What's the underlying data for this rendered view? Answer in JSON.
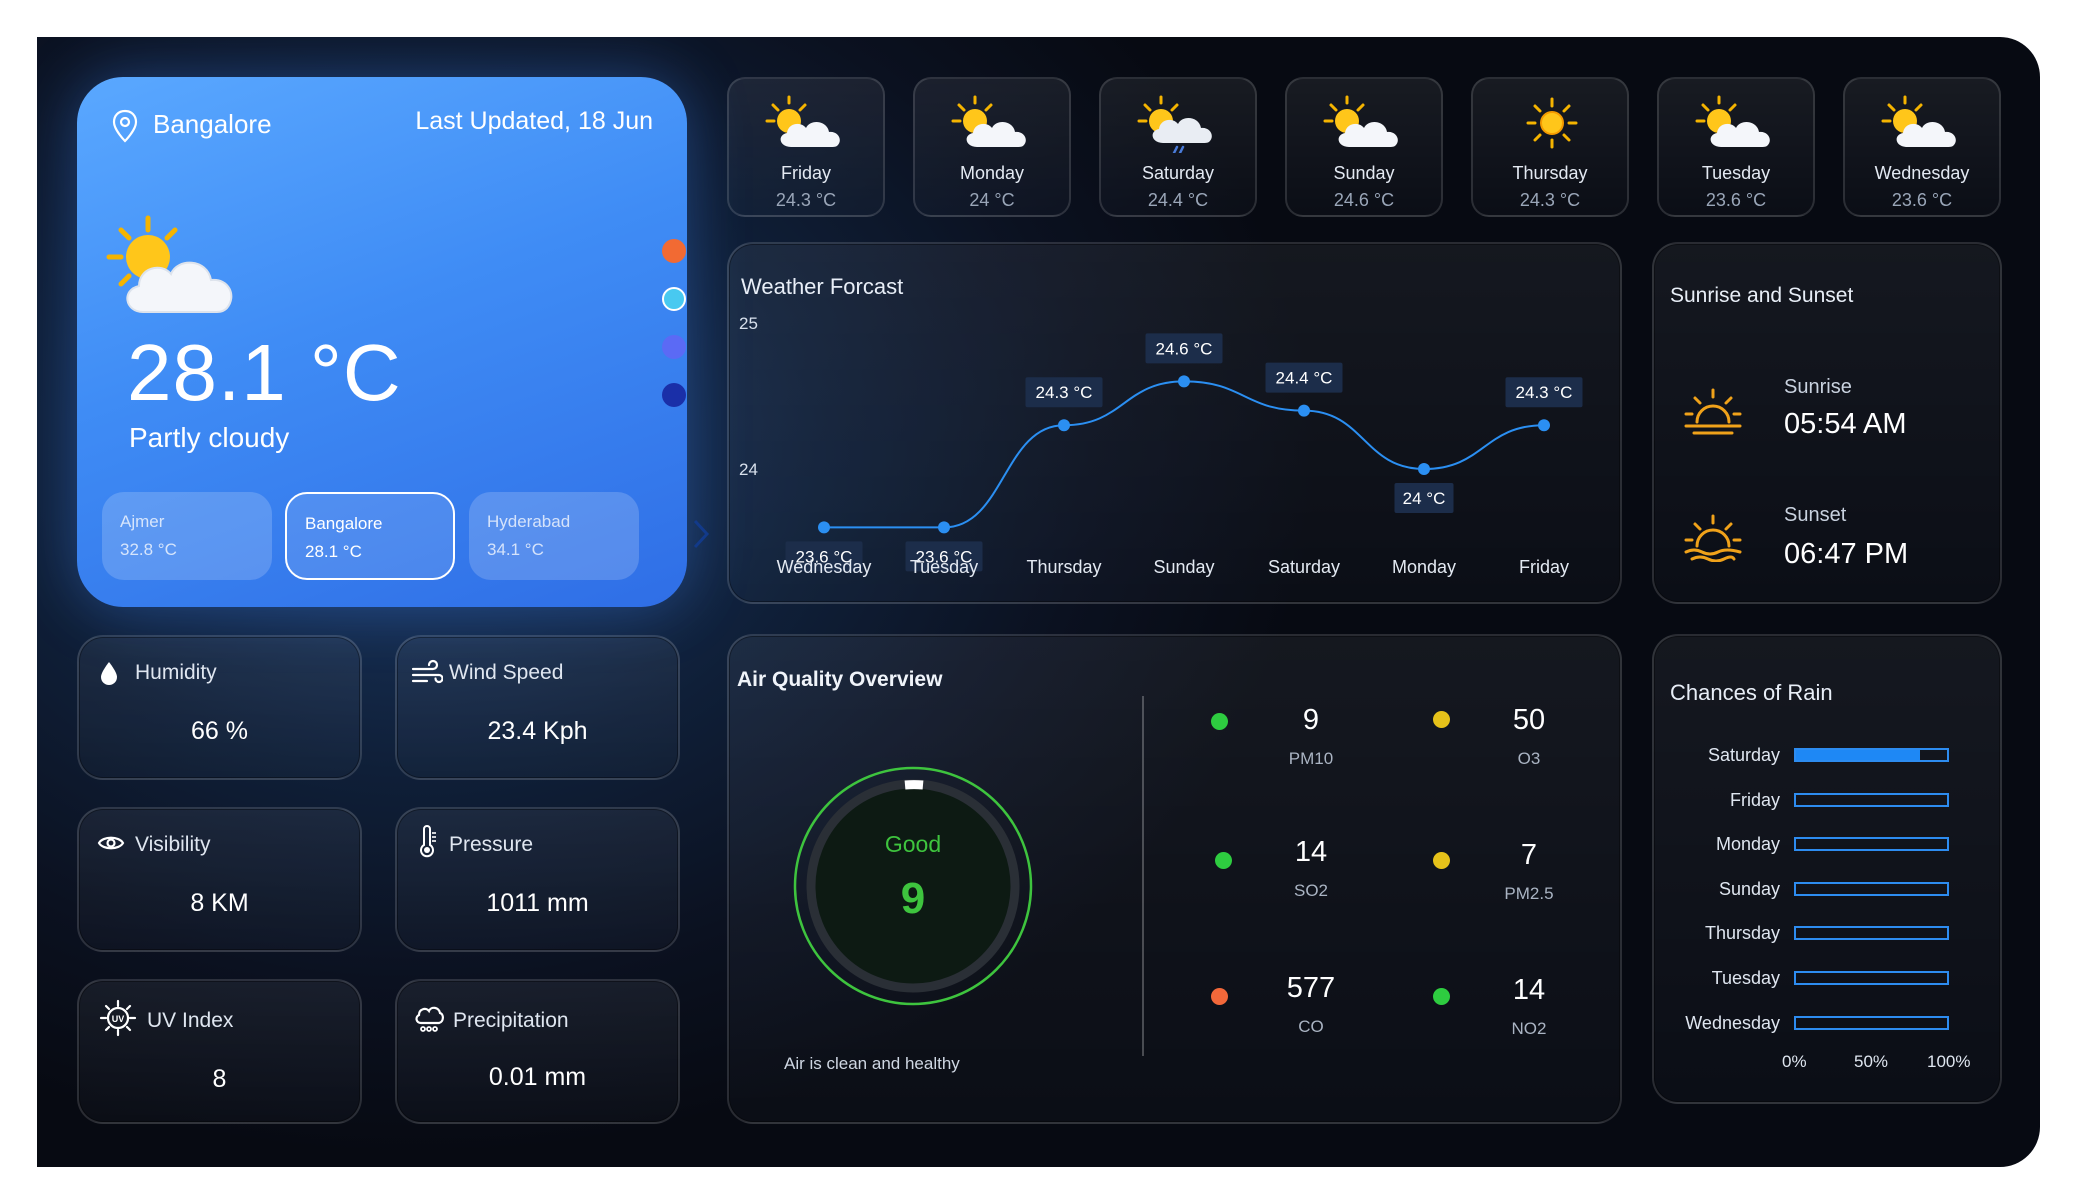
{
  "location": {
    "city": "Bangalore",
    "last_updated": "Last Updated, 18 Jun",
    "temperature": "28.1 °C",
    "condition": "Partly cloudy",
    "indicator_colors": [
      "#f26a33",
      "#48c9f0",
      "#5b6af5",
      "#1a2fa8"
    ],
    "cities": [
      {
        "name": "Ajmer",
        "temp": "32.8 °C",
        "active": false
      },
      {
        "name": "Bangalore",
        "temp": "28.1 °C",
        "active": true
      },
      {
        "name": "Hyderabad",
        "temp": "34.1 °C",
        "active": false
      }
    ]
  },
  "daily": [
    {
      "day": "Friday",
      "temp": "24.3 °C",
      "icon": "sun-cloud-icon"
    },
    {
      "day": "Monday",
      "temp": "24 °C",
      "icon": "sun-cloud-icon"
    },
    {
      "day": "Saturday",
      "temp": "24.4 °C",
      "icon": "sun-cloud-rain-icon"
    },
    {
      "day": "Sunday",
      "temp": "24.6 °C",
      "icon": "sun-cloud-icon"
    },
    {
      "day": "Thursday",
      "temp": "24.3 °C",
      "icon": "sun-icon"
    },
    {
      "day": "Tuesday",
      "temp": "23.6 °C",
      "icon": "sun-cloud-icon"
    },
    {
      "day": "Wednesday",
      "temp": "23.6 °C",
      "icon": "sun-cloud-icon"
    }
  ],
  "forecast": {
    "title": "Weather Forcast"
  },
  "chart_data": {
    "type": "line",
    "title": "Weather Forcast",
    "categories": [
      "Wednesday",
      "Tuesday",
      "Thursday",
      "Sunday",
      "Saturday",
      "Monday",
      "Friday"
    ],
    "values": [
      23.6,
      23.6,
      24.3,
      24.6,
      24.4,
      24,
      24.3
    ],
    "point_labels": [
      "23.6 °C",
      "23.6 °C",
      "24.3 °C",
      "24.6 °C",
      "24.4 °C",
      "24 °C",
      "24.3 °C"
    ],
    "y_ticks": [
      "25",
      "24"
    ],
    "ylim": [
      23.5,
      25
    ],
    "line_color": "#2b8ff2",
    "grid": false
  },
  "sun": {
    "title": "Sunrise and Sunset",
    "sunrise_label": "Sunrise",
    "sunrise_time": "05:54 AM",
    "sunset_label": "Sunset",
    "sunset_time": "06:47 PM"
  },
  "stats": {
    "humidity": {
      "label": "Humidity",
      "value": "66 %"
    },
    "wind": {
      "label": "Wind Speed",
      "value": "23.4 Kph"
    },
    "visibility": {
      "label": "Visibility",
      "value": "8 KM"
    },
    "pressure": {
      "label": "Pressure",
      "value": "1011 mm"
    },
    "uv": {
      "label": "UV Index",
      "value": "8"
    },
    "precipitation": {
      "label": "Precipitation",
      "value": "0.01 mm"
    }
  },
  "air_quality": {
    "title": "Air Quality Overview",
    "status": "Good",
    "index": "9",
    "note": "Air is clean and healthy",
    "accent": "#3ec43e",
    "pollutants": [
      {
        "value": "9",
        "name": "PM10",
        "color": "#2ecc40"
      },
      {
        "value": "50",
        "name": "O3",
        "color": "#e6c21a"
      },
      {
        "value": "14",
        "name": "SO2",
        "color": "#2ecc40"
      },
      {
        "value": "7",
        "name": "PM2.5",
        "color": "#e6c21a"
      },
      {
        "value": "577",
        "name": "CO",
        "color": "#f2683a"
      },
      {
        "value": "14",
        "name": "NO2",
        "color": "#2ecc40"
      }
    ]
  },
  "rain": {
    "title": "Chances of Rain",
    "rows": [
      {
        "day": "Saturday",
        "percent": 82
      },
      {
        "day": "Friday",
        "percent": 0
      },
      {
        "day": "Monday",
        "percent": 0
      },
      {
        "day": "Sunday",
        "percent": 0
      },
      {
        "day": "Thursday",
        "percent": 0
      },
      {
        "day": "Tuesday",
        "percent": 0
      },
      {
        "day": "Wednesday",
        "percent": 0
      }
    ],
    "axis": [
      "0%",
      "50%",
      "100%"
    ]
  }
}
